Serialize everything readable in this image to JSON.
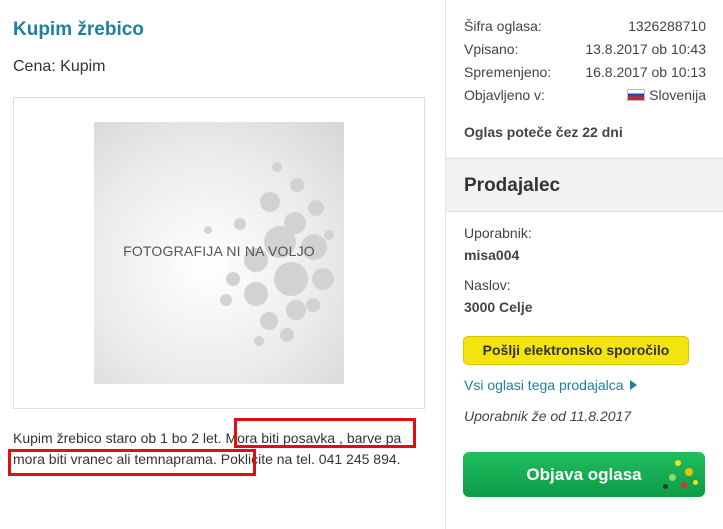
{
  "listing": {
    "title": "Kupim žrebico",
    "price": "Cena: Kupim",
    "photo_placeholder": "FOTOGRAFIJA NI NA VOLJO",
    "description": "Kupim žrebico staro ob 1 bo 2 let. Mora biti posavka , barve pa mora biti vranec ali temnaprama. Poklicite na tel. 041 245 894."
  },
  "info": {
    "rows": [
      {
        "key": "Šifra oglasa:",
        "value": "1326288710"
      },
      {
        "key": "Vpisano:",
        "value": "13.8.2017 ob 10:43"
      },
      {
        "key": "Spremenjeno:",
        "value": "16.8.2017 ob 10:13"
      },
      {
        "key": "Objavljeno v:",
        "value": "Slovenija"
      }
    ],
    "expiry": "Oglas poteče čez 22 dni"
  },
  "seller": {
    "heading": "Prodajalec",
    "user_label": "Uporabnik:",
    "user_value": "misa004",
    "address_label": "Naslov:",
    "address_value": "3000 Celje",
    "message_button": "Pošlji elektronsko sporočilo",
    "all_ads_link": "Vsi oglasi tega prodajalca",
    "member_since": "Uporabnik že od 11.8.2017"
  },
  "actions": {
    "publish_button": "Objava oglasa"
  },
  "colors": {
    "title": "#1f7fa0",
    "highlight": "#e01010",
    "message_button": "#f3e40f",
    "publish_button": "#14ac50"
  }
}
